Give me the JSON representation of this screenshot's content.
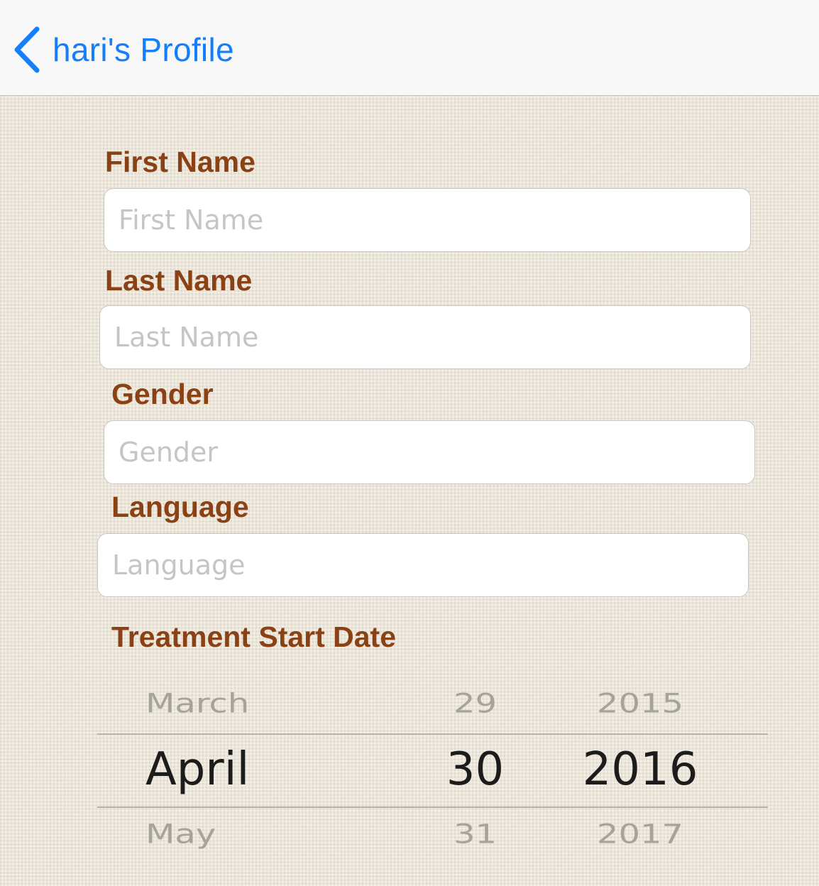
{
  "nav": {
    "back_label": "hari's Profile",
    "accent_color": "#147efb"
  },
  "form": {
    "label_color": "#8a4214",
    "first_name": {
      "label": "First Name",
      "placeholder": "First Name",
      "value": ""
    },
    "last_name": {
      "label": "Last Name",
      "placeholder": "Last Name",
      "value": ""
    },
    "gender": {
      "label": "Gender",
      "placeholder": "Gender",
      "value": ""
    },
    "language": {
      "label": "Language",
      "placeholder": "Language",
      "value": ""
    },
    "treatment_start_date": {
      "label": "Treatment Start Date",
      "picker": {
        "month": {
          "previous": "March",
          "selected": "April",
          "next": "May"
        },
        "day": {
          "previous": "29",
          "selected": "30",
          "next": "31"
        },
        "year": {
          "previous": "2015",
          "selected": "2016",
          "next": "2017"
        }
      }
    }
  },
  "icons": {
    "back": "chevron-left-icon"
  }
}
